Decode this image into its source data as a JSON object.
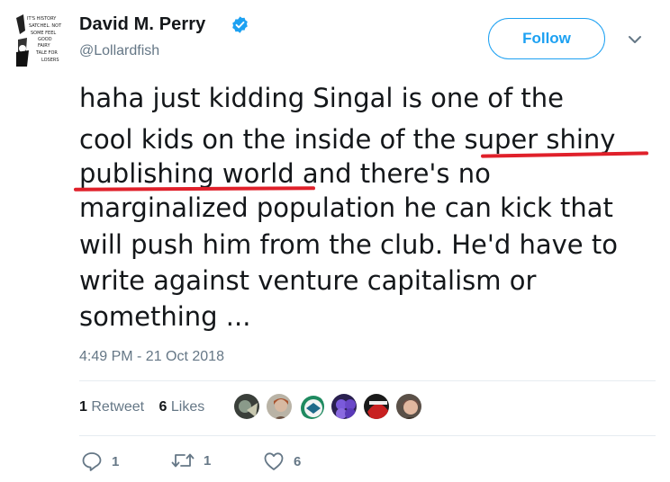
{
  "author": {
    "display_name": "David M. Perry",
    "handle": "@Lollardfish",
    "avatar_text": [
      "IT'S HISTORY",
      "SATCHEL. NOT",
      "SOME FEEL",
      "GOOD",
      "FAIRY",
      "TALE FOR",
      "LOSERS"
    ]
  },
  "follow_label": "Follow",
  "tweet_lines": [
    "haha just kidding Singal is one of the",
    "cool kids on the inside of the super shiny",
    "publishing world and there's no",
    "marginalized population he can kick that",
    "will push him from the club. He'd have to",
    "write against venture capitalism or",
    "something ..."
  ],
  "timestamp": "4:49 PM - 21 Oct 2018",
  "stats": {
    "retweets_count": "1",
    "retweets_label": "Retweet",
    "likes_count": "6",
    "likes_label": "Likes"
  },
  "actions": {
    "reply_count": "1",
    "retweet_count": "1",
    "like_count": "6"
  },
  "colors": {
    "accent": "#1da1f2",
    "annotation_underline": "#e0202a",
    "muted": "#657786"
  }
}
